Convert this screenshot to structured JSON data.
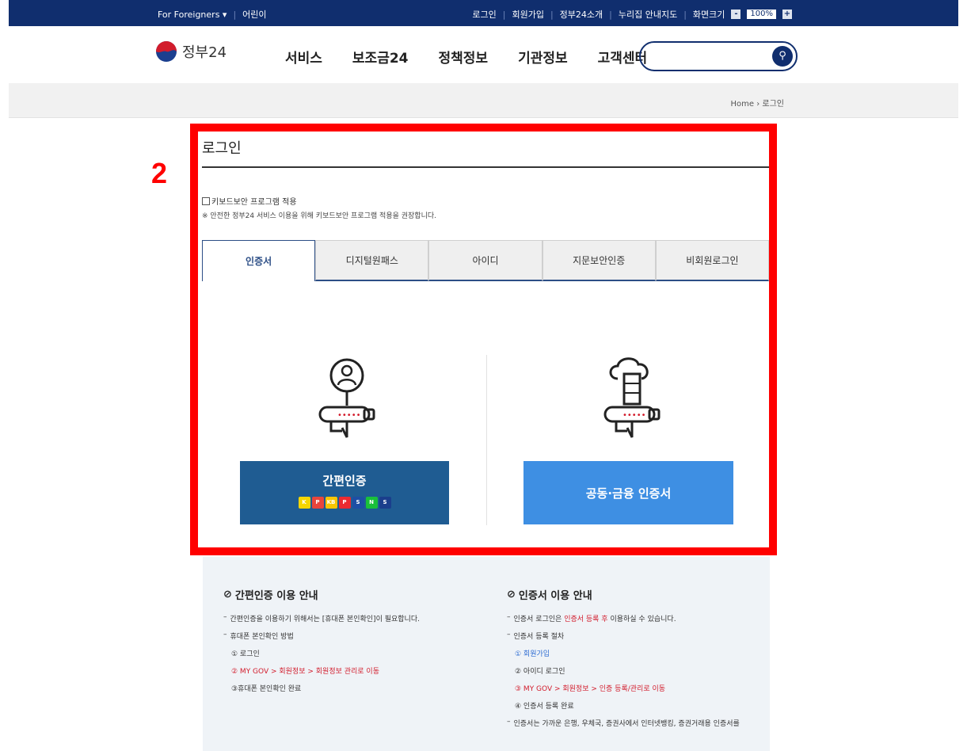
{
  "topbar": {
    "foreigners": "For Foreigners ▾",
    "kids": "어린이",
    "login": "로그인",
    "signup": "회원가입",
    "intro": "정부24소개",
    "sitemap": "누리집 안내지도",
    "screen_size": "화면크기",
    "zoom_minus": "-",
    "zoom_value": "100%",
    "zoom_plus": "+"
  },
  "header": {
    "logo_text": "정부24",
    "nav": [
      "서비스",
      "보조금24",
      "정책정보",
      "기관정보",
      "고객센터"
    ],
    "search_placeholder": "",
    "search_icon": "search-icon"
  },
  "breadcrumb": "Home  ›  로그인",
  "annotation": {
    "step": "2"
  },
  "login": {
    "title": "로그인",
    "keyboard_security_label": "키보드보안 프로그램 적용",
    "keyboard_security_note": "※ 안전한 정부24 서비스 이용을 위해 키보드보안 프로그램 적용을 권장합니다.",
    "tabs": [
      "인증서",
      "디지털원패스",
      "아이디",
      "지문보안인증",
      "비회원로그인"
    ],
    "active_tab": 0,
    "simple_auth_label": "간편인증",
    "joint_cert_label": "공동·금융 인증서",
    "providers": [
      {
        "name": "kakao",
        "color": "#f7d600",
        "text": "K"
      },
      {
        "name": "pass",
        "color": "#e8453c",
        "text": "P"
      },
      {
        "name": "kb",
        "color": "#f8c500",
        "text": "KB"
      },
      {
        "name": "payco",
        "color": "#ea2a31",
        "text": "P"
      },
      {
        "name": "samsung",
        "color": "#1d4fa5",
        "text": "S"
      },
      {
        "name": "naver",
        "color": "#19c03a",
        "text": "N"
      },
      {
        "name": "shinhan",
        "color": "#1a3e8c",
        "text": "S"
      }
    ]
  },
  "guide": {
    "simple": {
      "title": "간편인증 이용 안내",
      "line1": "간편인증을 이용하기 위해서는 [휴대폰 본인확인]이 필요합니다.",
      "line2": "휴대폰 본인확인 방법",
      "step1": "① 로그인",
      "step2": "② MY GOV > 회원정보 > 회원정보 관리로 이동",
      "step3": "③휴대폰 본인확인 완료"
    },
    "cert": {
      "title": "인증서 이용 안내",
      "line1_pre": "인증서 로그인은 ",
      "line1_red": "인증서 등록 후",
      "line1_post": " 이용하실 수 있습니다.",
      "line2": "인증서 등록 절차",
      "step1": "① 회원가입",
      "step2": "② 아이디 로그인",
      "step3": "③ MY GOV > 회원정보 > 인증 등록/관리로 이동",
      "step4": "④ 인증서 등록 완료",
      "line3": "인증서는 가까운 은행, 우체국, 증권사에서 인터넷뱅킹, 증권거래용 인증서를"
    }
  }
}
